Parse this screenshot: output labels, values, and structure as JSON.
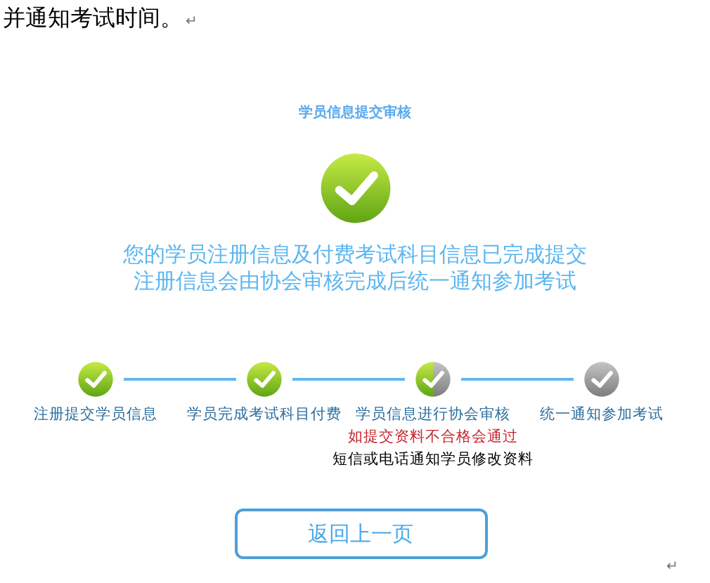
{
  "document_text": {
    "text": "并通知考试时间。",
    "mark": "↵"
  },
  "page": {
    "title": "学员信息提交审核",
    "message": [
      "您的学员注册信息及付费考试科目信息已完成提交",
      "注册信息会由协会审核完成后统一通知参加考试"
    ],
    "steps": [
      {
        "label": "注册提交学员信息",
        "kind": "done"
      },
      {
        "label": "学员完成考试科目付费",
        "kind": "done"
      },
      {
        "label": "学员信息进行协会审核",
        "kind": "partial",
        "notes": [
          {
            "text": "如提交资料不合格会通过",
            "kind": "warning"
          },
          {
            "text": "短信或电话通知学员修改资料",
            "kind": "plain"
          }
        ]
      },
      {
        "label": "统一通知参加考试",
        "kind": "pending"
      }
    ],
    "back_button": "返回上一页"
  },
  "end_mark": "↵"
}
